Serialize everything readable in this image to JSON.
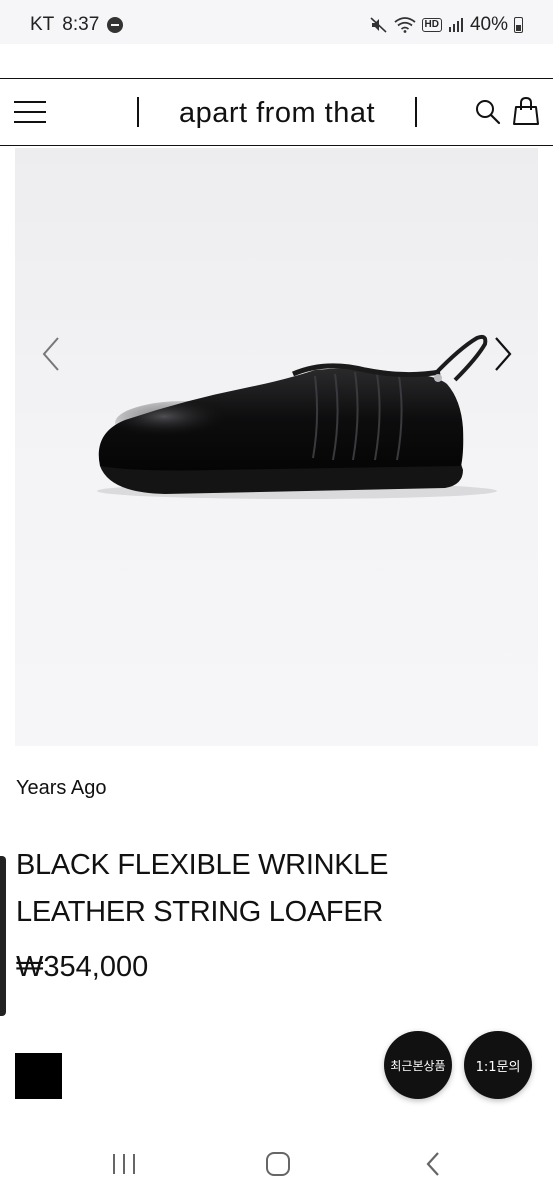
{
  "status_bar": {
    "carrier": "KT",
    "time": "8:37",
    "hd_label": "HD",
    "battery": "40%",
    "icons": [
      "notification-dot-icon",
      "mute-icon",
      "wifi-icon",
      "hd-voice-icon",
      "signal-icon",
      "battery-icon"
    ]
  },
  "header": {
    "logo": "apart from that",
    "icons": [
      "menu-icon",
      "search-icon",
      "shopping-bag-icon"
    ]
  },
  "product_image": {
    "alt_icon": "black-leather-loafer-image",
    "nav_icons": [
      "chevron-left-icon",
      "chevron-right-icon"
    ]
  },
  "product": {
    "brand": "Years Ago",
    "title": "BLACK FLEXIBLE WRINKLE LEATHER STRING LOAFER",
    "price": "₩354,000",
    "color_swatch": "#000000"
  },
  "floating_buttons": {
    "recent": "최근본상품",
    "inquiry": "1:1문의"
  },
  "nav_bar": {
    "icons": [
      "recents-icon",
      "home-icon",
      "back-icon"
    ]
  }
}
